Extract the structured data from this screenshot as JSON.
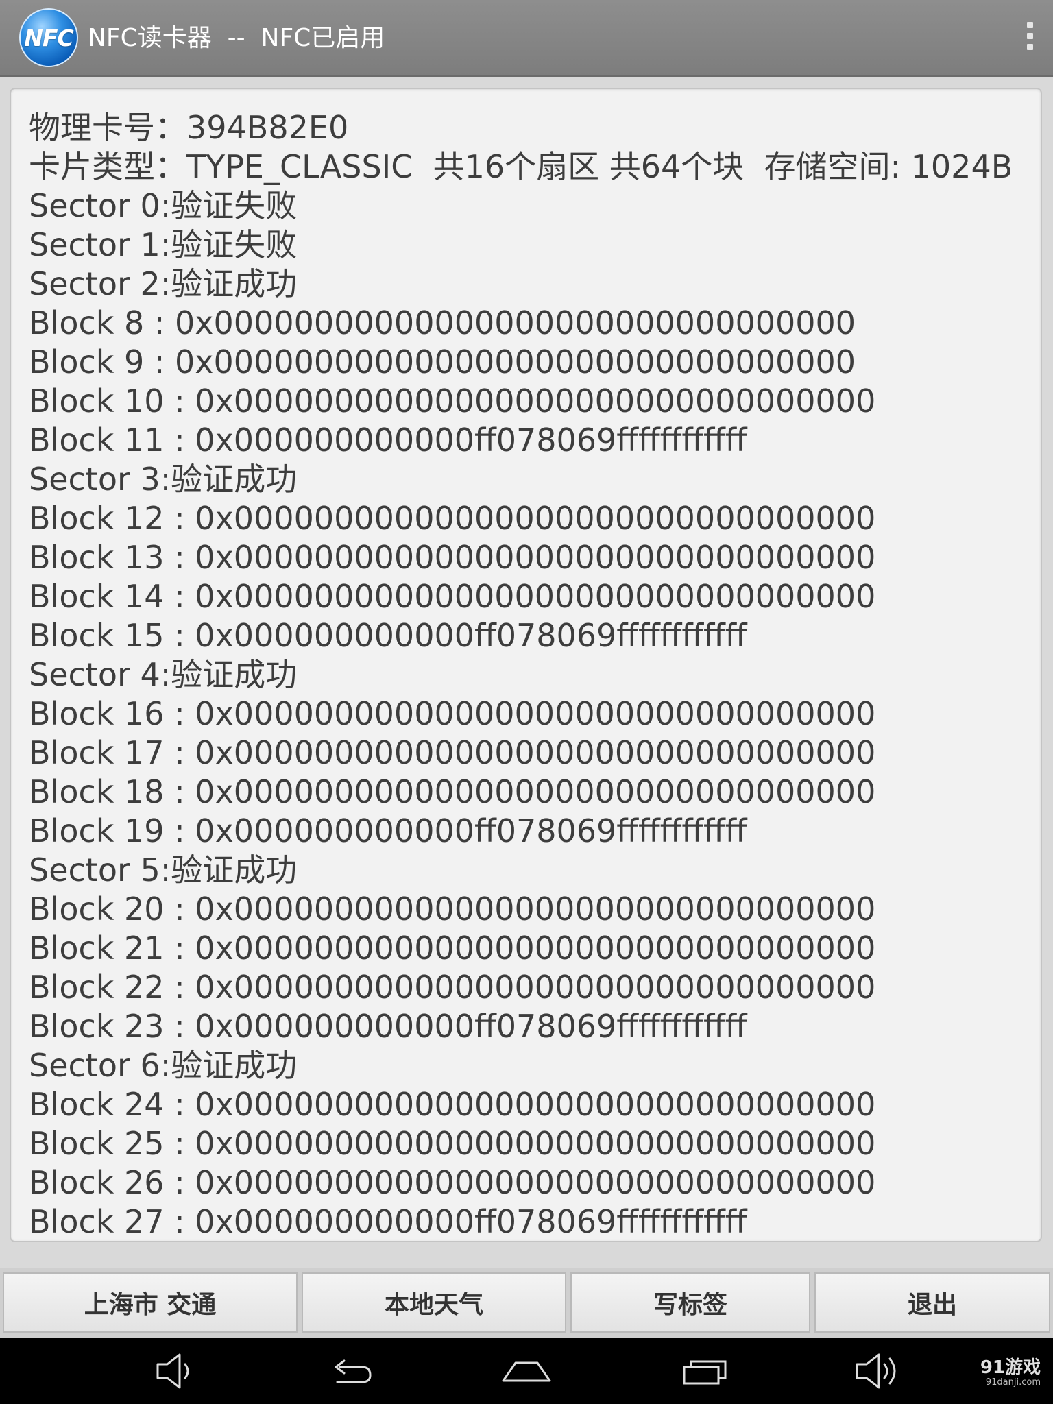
{
  "action_bar": {
    "app_icon_text": "NFC",
    "title": "NFC读卡器  --  NFC已启用",
    "overflow_icon": "overflow-menu-icon"
  },
  "content": {
    "lines": [
      "物理卡号：394B82E0",
      "卡片类型：TYPE_CLASSIC  共16个扇区 共64个块  存储空间: 1024B",
      "Sector 0:验证失败",
      "Sector 1:验证失败",
      "Sector 2:验证成功",
      "Block 8 : 0x00000000000000000000000000000000",
      "Block 9 : 0x00000000000000000000000000000000",
      "Block 10 : 0x00000000000000000000000000000000",
      "Block 11 : 0x000000000000ff078069ffffffffffff",
      "Sector 3:验证成功",
      "Block 12 : 0x00000000000000000000000000000000",
      "Block 13 : 0x00000000000000000000000000000000",
      "Block 14 : 0x00000000000000000000000000000000",
      "Block 15 : 0x000000000000ff078069ffffffffffff",
      "Sector 4:验证成功",
      "Block 16 : 0x00000000000000000000000000000000",
      "Block 17 : 0x00000000000000000000000000000000",
      "Block 18 : 0x00000000000000000000000000000000",
      "Block 19 : 0x000000000000ff078069ffffffffffff",
      "Sector 5:验证成功",
      "Block 20 : 0x00000000000000000000000000000000",
      "Block 21 : 0x00000000000000000000000000000000",
      "Block 22 : 0x00000000000000000000000000000000",
      "Block 23 : 0x000000000000ff078069ffffffffffff",
      "Sector 6:验证成功",
      "Block 24 : 0x00000000000000000000000000000000",
      "Block 25 : 0x00000000000000000000000000000000",
      "Block 26 : 0x00000000000000000000000000000000",
      "Block 27 : 0x000000000000ff078069ffffffffffff"
    ]
  },
  "buttons": {
    "shanghai_transit": "上海市 交通",
    "local_weather": "本地天气",
    "write_tag": "写标签",
    "exit": "退出"
  },
  "nav_bar": {
    "icons": [
      "volume-down-icon",
      "back-icon",
      "home-icon",
      "recent-apps-icon",
      "volume-up-icon"
    ]
  },
  "watermark": {
    "main": "91游戏",
    "sub": "91danji.com"
  },
  "colors": {
    "action_bar": "#858585",
    "content_background": "#f2f2f2",
    "text": "#3d3d3d",
    "nav_bar": "#000000"
  }
}
